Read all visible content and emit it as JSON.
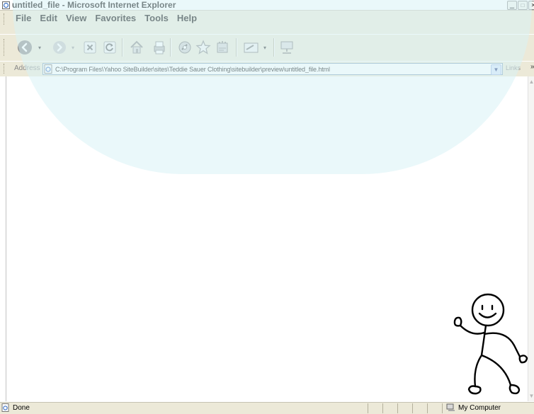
{
  "window": {
    "title": "untitled_file - Microsoft Internet Explorer",
    "buttons": [
      "minimize",
      "maximize",
      "close"
    ]
  },
  "menubar": {
    "items": [
      {
        "label": "File"
      },
      {
        "label": "Edit"
      },
      {
        "label": "View"
      },
      {
        "label": "Favorites"
      },
      {
        "label": "Tools"
      },
      {
        "label": "Help"
      }
    ]
  },
  "toolbar": {
    "buttons": [
      {
        "icon": "back-icon"
      },
      {
        "icon": "forward-icon"
      },
      {
        "icon": "stop-icon"
      },
      {
        "icon": "refresh-icon"
      },
      {
        "icon": "home-icon"
      },
      {
        "icon": "print-icon"
      },
      {
        "icon": "media-icon"
      },
      {
        "icon": "favorites-star-icon"
      },
      {
        "icon": "history-icon"
      },
      {
        "icon": "edit-icon"
      },
      {
        "icon": "network-icon"
      }
    ]
  },
  "addressbar": {
    "label": "Address",
    "url": "C:\\Program Files\\Yahoo SiteBuilder\\sites\\Teddie Sauer Clothing\\sitebuilder\\preview\\untitled_file.html",
    "links_label": "Links"
  },
  "statusbar": {
    "status": "Done",
    "zone": "My Computer"
  },
  "colors": {
    "chrome": "#ece9d8",
    "watermark": "#bfe8ef"
  }
}
